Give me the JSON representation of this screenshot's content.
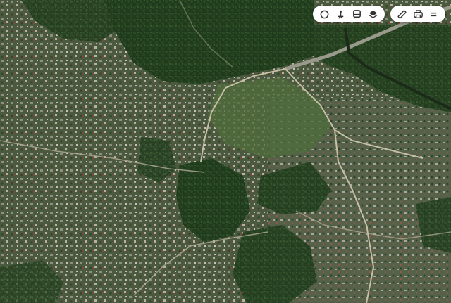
{
  "map": {
    "type": "satellite",
    "tint": "#2f4a2a"
  },
  "toolbar_layers": {
    "buttons": [
      {
        "icon": "traffic-icon"
      },
      {
        "icon": "transit-icon"
      },
      {
        "icon": "bus-icon"
      },
      {
        "icon": "layers-icon"
      }
    ]
  },
  "toolbar_tools": {
    "buttons": [
      {
        "icon": "ruler-icon"
      },
      {
        "icon": "print-icon"
      },
      {
        "icon": "menu-icon"
      }
    ]
  }
}
